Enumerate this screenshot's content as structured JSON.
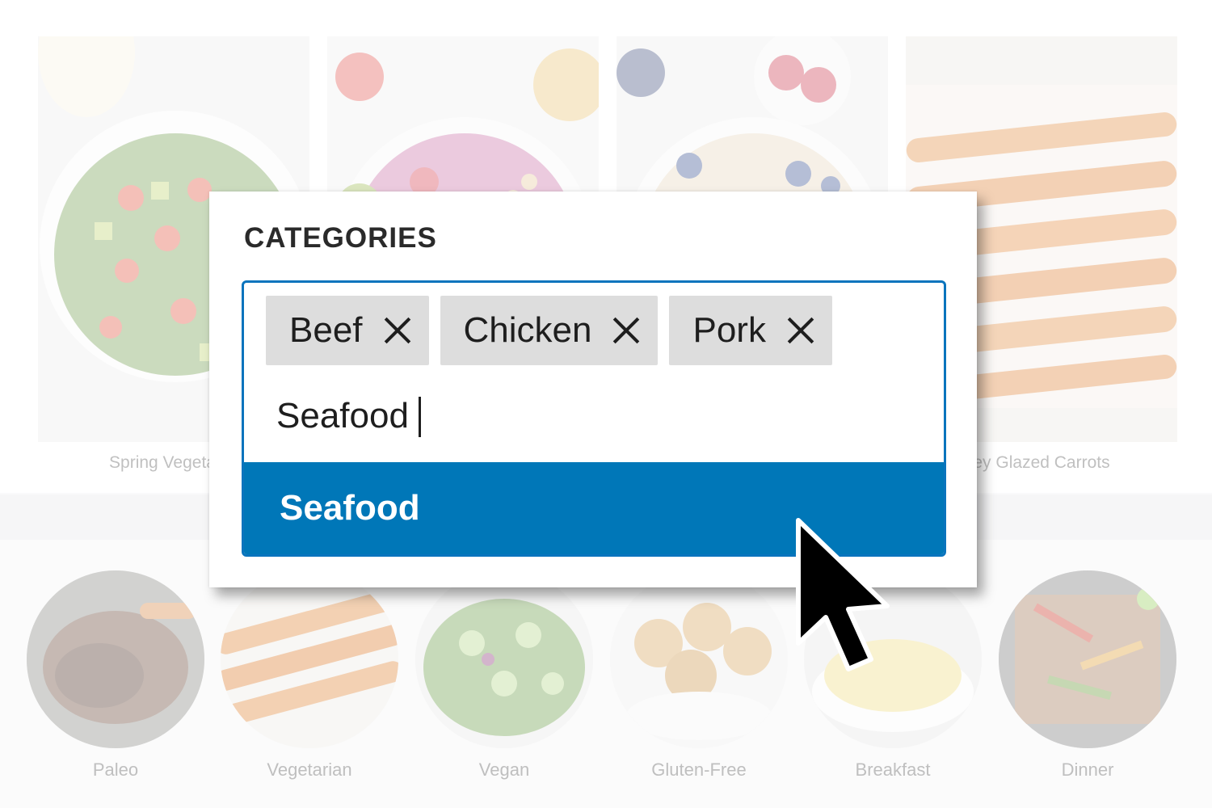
{
  "recipes": [
    {
      "caption": "Spring Vegetable",
      "image": "kale-salad-photo"
    },
    {
      "caption": "",
      "image": "smoothie-bowl-photo"
    },
    {
      "caption": "",
      "image": "oatmeal-bowl-photo"
    },
    {
      "caption": "ey Glazed Carrots",
      "image": "glazed-carrots-photo"
    }
  ],
  "categories": [
    {
      "label": "Paleo",
      "image": "pot-roast-photo"
    },
    {
      "label": "Vegetarian",
      "image": "carrots-photo"
    },
    {
      "label": "Vegan",
      "image": "green-salad-photo"
    },
    {
      "label": "Gluten-Free",
      "image": "muffins-photo"
    },
    {
      "label": "Breakfast",
      "image": "omelette-photo"
    },
    {
      "label": "Dinner",
      "image": "fajitas-photo"
    }
  ],
  "popup": {
    "title": "CATEGORIES",
    "chips": [
      {
        "label": "Beef",
        "remove_icon": "close-icon"
      },
      {
        "label": "Chicken",
        "remove_icon": "close-icon"
      },
      {
        "label": "Pork",
        "remove_icon": "close-icon"
      }
    ],
    "input_value": "Seafood",
    "suggestion": "Seafood"
  },
  "colors": {
    "accent": "#0077b8",
    "focus_border": "#0a74bd",
    "chip_bg": "#dddddd"
  },
  "cursor": {
    "icon": "mouse-pointer-icon"
  }
}
